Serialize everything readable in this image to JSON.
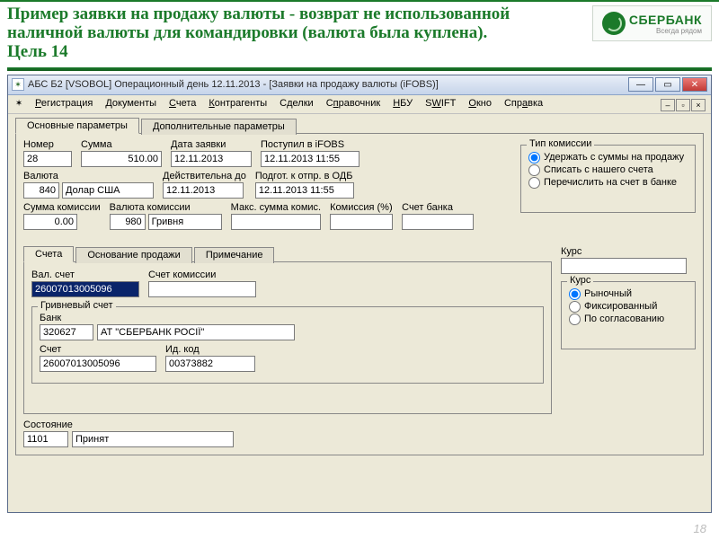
{
  "slide": {
    "title": "Пример заявки на продажу валюты - возврат не использованной наличной валюты для командировки (валюта была куплена). Цель 14",
    "logo_text": "СБЕРБАНК",
    "logo_tagline": "Всегда рядом",
    "page_number": "18"
  },
  "window": {
    "title": "АБС Б2 [VSOBOL] Операционный день 12.11.2013 - [Заявки на продажу валюты (iFOBS)]"
  },
  "menu": {
    "items": [
      "Регистрация",
      "Документы",
      "Счета",
      "Контрагенты",
      "Сделки",
      "Справочник",
      "НБУ",
      "SWIFT",
      "Окно",
      "Справка"
    ]
  },
  "main_tabs": {
    "t0": "Основные параметры",
    "t1": "Дополнительные параметры"
  },
  "fields": {
    "number_label": "Номер",
    "number": "28",
    "amount_label": "Сумма",
    "amount": "510.00",
    "date_label": "Дата заявки",
    "date": "12.11.2013",
    "received_label": "Поступил в iFOBS",
    "received": "12.11.2013 11:55",
    "currency_label": "Валюта",
    "currency_code": "840",
    "currency_name": "Долар США",
    "valid_label": "Действительна до",
    "valid": "12.11.2013",
    "sent_label": "Подгот. к отпр. в ОДБ",
    "sent": "12.11.2013 11:55",
    "comm_amount_label": "Сумма комиссии",
    "comm_amount": "0.00",
    "comm_curr_label": "Валюта комиссии",
    "comm_curr_code": "980",
    "comm_curr_name": "Гривня",
    "max_comm_label": "Макс. сумма комис.",
    "max_comm": "",
    "comm_pct_label": "Комиссия (%)",
    "comm_pct": "",
    "bank_acct_label": "Счет банка",
    "bank_acct": ""
  },
  "commission_group": {
    "title": "Тип комиссии",
    "r0": "Удержать с суммы на продажу",
    "r1": "Списать с нашего счета",
    "r2": "Перечислить на счет в банке"
  },
  "sub_tabs": {
    "t0": "Счета",
    "t1": "Основание продажи",
    "t2": "Примечание"
  },
  "accounts": {
    "val_label": "Вал. счет",
    "val": "26007013005096",
    "comm_label": "Счет комиссии",
    "comm": "",
    "uah_group": "Гривневый счет",
    "bank_label": "Банк",
    "bank_code": "320627",
    "bank_name": "АТ \"СБЕРБАНК РОСІЇ\"",
    "acct_label": "Счет",
    "acct": "26007013005096",
    "id_label": "Ид. код",
    "id": "00373882"
  },
  "rate": {
    "title": "Курс",
    "value": "",
    "group": "Курс",
    "r0": "Рыночный",
    "r1": "Фиксированный",
    "r2": "По согласованию"
  },
  "state": {
    "label": "Состояние",
    "code": "1101",
    "text": "Принят"
  }
}
